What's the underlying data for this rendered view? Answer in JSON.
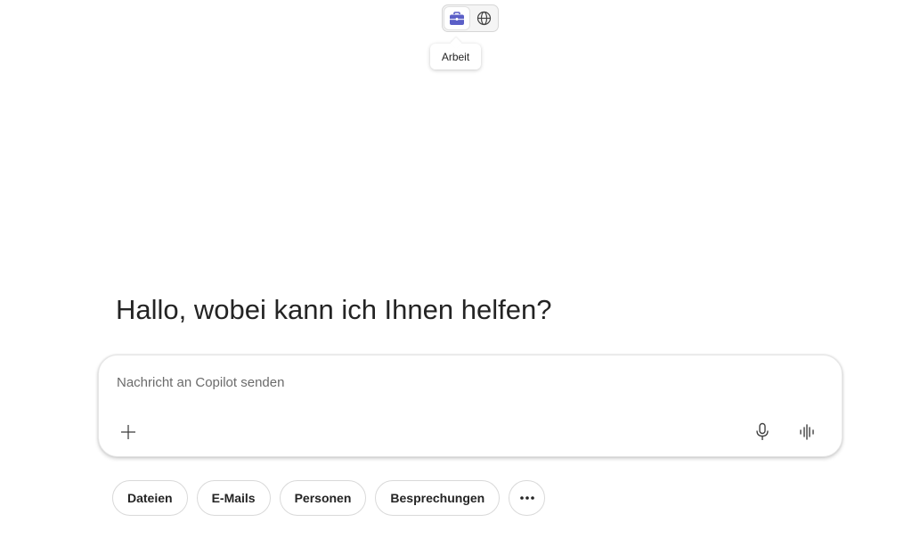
{
  "mode_toggle": {
    "options": [
      {
        "id": "work",
        "icon": "briefcase-icon",
        "active": true,
        "color": "#5b5fc7"
      },
      {
        "id": "web",
        "icon": "globe-icon",
        "active": false,
        "color": "#424242"
      }
    ]
  },
  "tooltip": {
    "text": "Arbeit"
  },
  "greeting": "Hallo, wobei kann ich Ihnen helfen?",
  "composer": {
    "placeholder": "Nachricht an Copilot senden",
    "value": ""
  },
  "chips": [
    {
      "label": "Dateien"
    },
    {
      "label": "E-Mails"
    },
    {
      "label": "Personen"
    },
    {
      "label": "Besprechungen"
    }
  ],
  "more_icon": "more-horizontal-icon"
}
